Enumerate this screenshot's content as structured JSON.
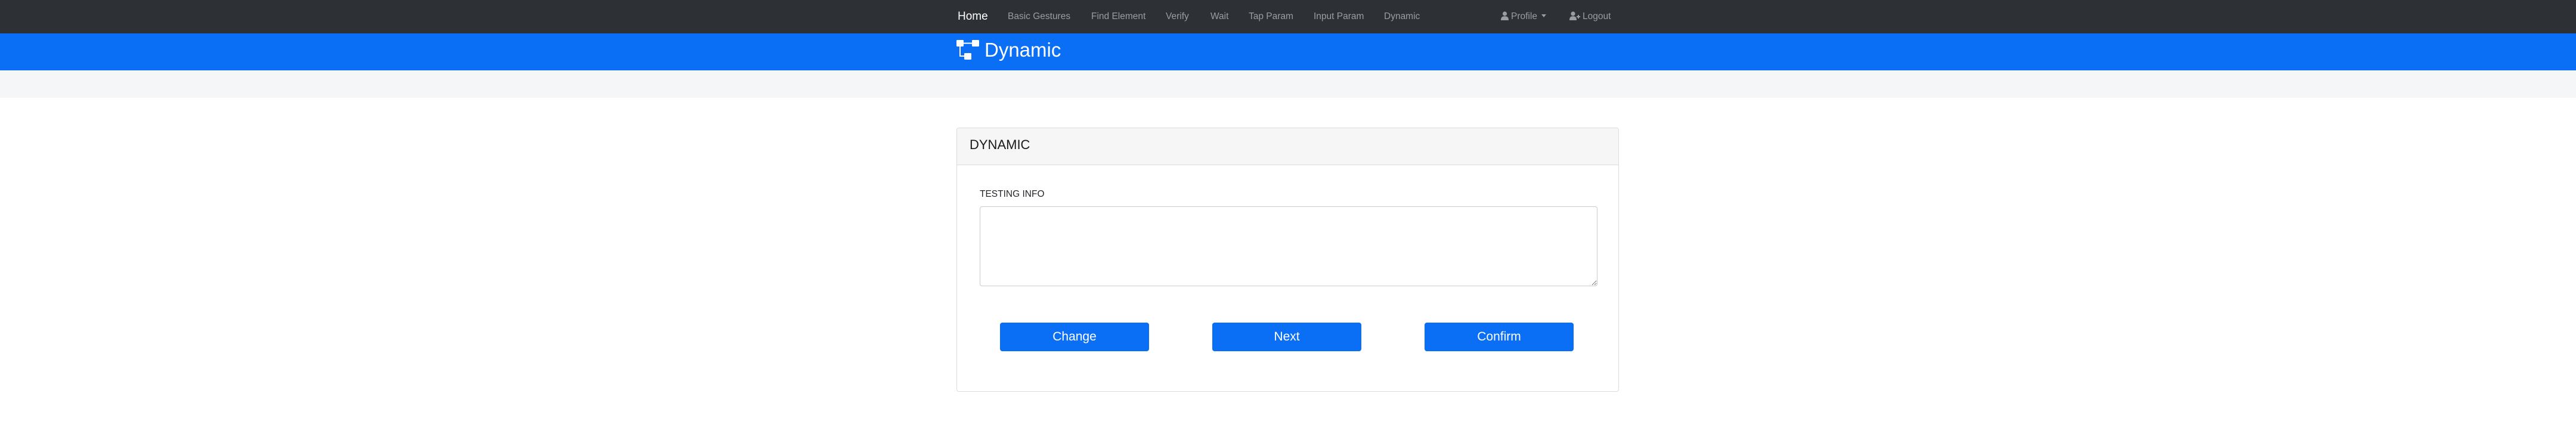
{
  "navbar": {
    "brand": "Home",
    "links": [
      "Basic Gestures",
      "Find Element",
      "Verify",
      "Wait",
      "Tap Param",
      "Input Param",
      "Dynamic"
    ],
    "profile_label": "Profile",
    "logout_label": "Logout"
  },
  "header": {
    "title": "Dynamic",
    "icon": "sitemap-icon"
  },
  "card": {
    "title": "DYNAMIC",
    "field_label": "TESTING INFO",
    "textarea_value": "",
    "buttons": {
      "change": "Change",
      "next": "Next",
      "confirm": "Confirm"
    }
  },
  "colors": {
    "navbar_bg": "#2d3035",
    "accent": "#0a6ff5",
    "band_bg": "#f5f6f8"
  }
}
